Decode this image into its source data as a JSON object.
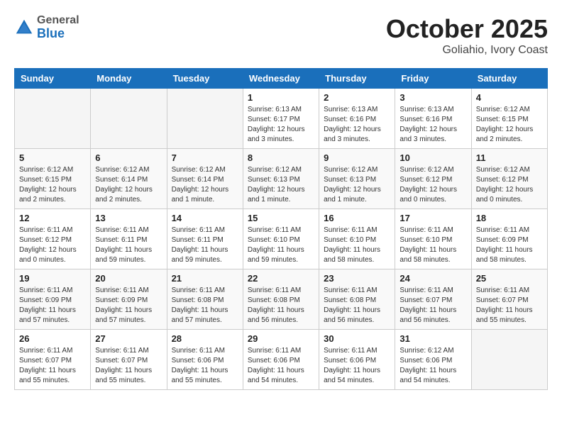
{
  "header": {
    "logo_general": "General",
    "logo_blue": "Blue",
    "month_title": "October 2025",
    "location": "Goliahio, Ivory Coast"
  },
  "weekdays": [
    "Sunday",
    "Monday",
    "Tuesday",
    "Wednesday",
    "Thursday",
    "Friday",
    "Saturday"
  ],
  "weeks": [
    [
      {
        "num": "",
        "info": ""
      },
      {
        "num": "",
        "info": ""
      },
      {
        "num": "",
        "info": ""
      },
      {
        "num": "1",
        "info": "Sunrise: 6:13 AM\nSunset: 6:17 PM\nDaylight: 12 hours\nand 3 minutes."
      },
      {
        "num": "2",
        "info": "Sunrise: 6:13 AM\nSunset: 6:16 PM\nDaylight: 12 hours\nand 3 minutes."
      },
      {
        "num": "3",
        "info": "Sunrise: 6:13 AM\nSunset: 6:16 PM\nDaylight: 12 hours\nand 3 minutes."
      },
      {
        "num": "4",
        "info": "Sunrise: 6:12 AM\nSunset: 6:15 PM\nDaylight: 12 hours\nand 2 minutes."
      }
    ],
    [
      {
        "num": "5",
        "info": "Sunrise: 6:12 AM\nSunset: 6:15 PM\nDaylight: 12 hours\nand 2 minutes."
      },
      {
        "num": "6",
        "info": "Sunrise: 6:12 AM\nSunset: 6:14 PM\nDaylight: 12 hours\nand 2 minutes."
      },
      {
        "num": "7",
        "info": "Sunrise: 6:12 AM\nSunset: 6:14 PM\nDaylight: 12 hours\nand 1 minute."
      },
      {
        "num": "8",
        "info": "Sunrise: 6:12 AM\nSunset: 6:13 PM\nDaylight: 12 hours\nand 1 minute."
      },
      {
        "num": "9",
        "info": "Sunrise: 6:12 AM\nSunset: 6:13 PM\nDaylight: 12 hours\nand 1 minute."
      },
      {
        "num": "10",
        "info": "Sunrise: 6:12 AM\nSunset: 6:12 PM\nDaylight: 12 hours\nand 0 minutes."
      },
      {
        "num": "11",
        "info": "Sunrise: 6:12 AM\nSunset: 6:12 PM\nDaylight: 12 hours\nand 0 minutes."
      }
    ],
    [
      {
        "num": "12",
        "info": "Sunrise: 6:11 AM\nSunset: 6:12 PM\nDaylight: 12 hours\nand 0 minutes."
      },
      {
        "num": "13",
        "info": "Sunrise: 6:11 AM\nSunset: 6:11 PM\nDaylight: 11 hours\nand 59 minutes."
      },
      {
        "num": "14",
        "info": "Sunrise: 6:11 AM\nSunset: 6:11 PM\nDaylight: 11 hours\nand 59 minutes."
      },
      {
        "num": "15",
        "info": "Sunrise: 6:11 AM\nSunset: 6:10 PM\nDaylight: 11 hours\nand 59 minutes."
      },
      {
        "num": "16",
        "info": "Sunrise: 6:11 AM\nSunset: 6:10 PM\nDaylight: 11 hours\nand 58 minutes."
      },
      {
        "num": "17",
        "info": "Sunrise: 6:11 AM\nSunset: 6:10 PM\nDaylight: 11 hours\nand 58 minutes."
      },
      {
        "num": "18",
        "info": "Sunrise: 6:11 AM\nSunset: 6:09 PM\nDaylight: 11 hours\nand 58 minutes."
      }
    ],
    [
      {
        "num": "19",
        "info": "Sunrise: 6:11 AM\nSunset: 6:09 PM\nDaylight: 11 hours\nand 57 minutes."
      },
      {
        "num": "20",
        "info": "Sunrise: 6:11 AM\nSunset: 6:09 PM\nDaylight: 11 hours\nand 57 minutes."
      },
      {
        "num": "21",
        "info": "Sunrise: 6:11 AM\nSunset: 6:08 PM\nDaylight: 11 hours\nand 57 minutes."
      },
      {
        "num": "22",
        "info": "Sunrise: 6:11 AM\nSunset: 6:08 PM\nDaylight: 11 hours\nand 56 minutes."
      },
      {
        "num": "23",
        "info": "Sunrise: 6:11 AM\nSunset: 6:08 PM\nDaylight: 11 hours\nand 56 minutes."
      },
      {
        "num": "24",
        "info": "Sunrise: 6:11 AM\nSunset: 6:07 PM\nDaylight: 11 hours\nand 56 minutes."
      },
      {
        "num": "25",
        "info": "Sunrise: 6:11 AM\nSunset: 6:07 PM\nDaylight: 11 hours\nand 55 minutes."
      }
    ],
    [
      {
        "num": "26",
        "info": "Sunrise: 6:11 AM\nSunset: 6:07 PM\nDaylight: 11 hours\nand 55 minutes."
      },
      {
        "num": "27",
        "info": "Sunrise: 6:11 AM\nSunset: 6:07 PM\nDaylight: 11 hours\nand 55 minutes."
      },
      {
        "num": "28",
        "info": "Sunrise: 6:11 AM\nSunset: 6:06 PM\nDaylight: 11 hours\nand 55 minutes."
      },
      {
        "num": "29",
        "info": "Sunrise: 6:11 AM\nSunset: 6:06 PM\nDaylight: 11 hours\nand 54 minutes."
      },
      {
        "num": "30",
        "info": "Sunrise: 6:11 AM\nSunset: 6:06 PM\nDaylight: 11 hours\nand 54 minutes."
      },
      {
        "num": "31",
        "info": "Sunrise: 6:12 AM\nSunset: 6:06 PM\nDaylight: 11 hours\nand 54 minutes."
      },
      {
        "num": "",
        "info": ""
      }
    ]
  ]
}
